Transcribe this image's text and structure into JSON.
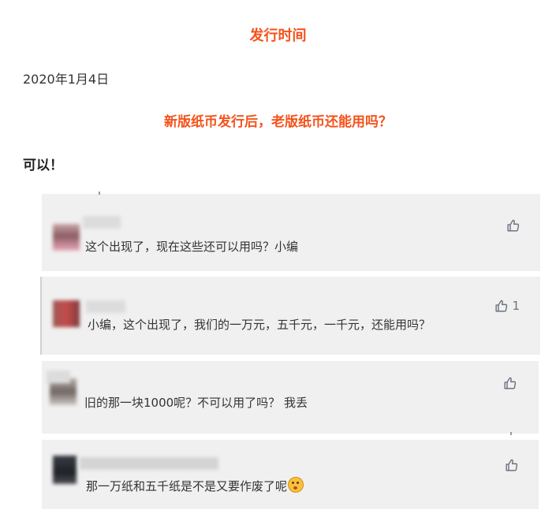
{
  "article": {
    "section_title": "发行时间",
    "release_date": "2020年1月4日",
    "question": "新版纸币发行后，老版纸币还能用吗？",
    "answer": "可以！"
  },
  "comments": [
    {
      "text": "这个出现了，现在这些还可以用吗？小编",
      "likes": ""
    },
    {
      "text": "小编，这个出现了，我们的一万元，五千元，一千元，还能用吗？",
      "likes": "1"
    },
    {
      "text": "旧的那一块1000呢？不可以用了吗？ 我丢",
      "likes": ""
    },
    {
      "text": "那一万纸和五千纸是不是又要作废了呢",
      "likes": ""
    }
  ],
  "icons": {
    "like": "thumbs-up-icon",
    "emoji": "flushed-face-emoji-icon"
  },
  "colors": {
    "accent": "#f5521b",
    "card_background": "#f0f0f0",
    "like_icon": "#6b7280"
  }
}
